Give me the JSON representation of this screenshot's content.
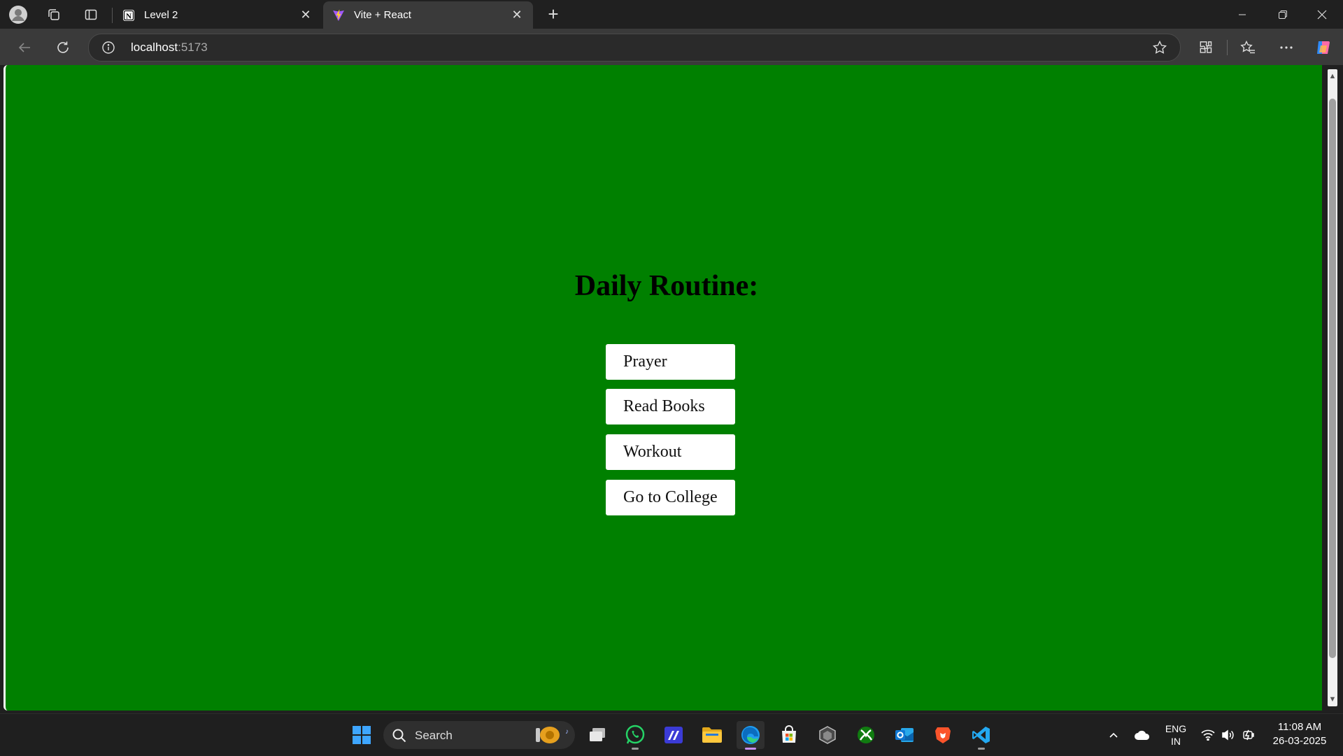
{
  "browser": {
    "tabs": [
      {
        "title": "Level 2",
        "active": false
      },
      {
        "title": "Vite + React",
        "active": true
      }
    ],
    "url_host": "localhost",
    "url_port": ":5173"
  },
  "page": {
    "heading": "Daily Routine:",
    "buttons": [
      "Prayer",
      "Read Books",
      "Workout",
      "Go to College"
    ],
    "background": "#008000"
  },
  "taskbar": {
    "search_label": "Search",
    "language": "ENG",
    "region": "IN",
    "time": "11:08 AM",
    "date": "26-03-2025"
  },
  "colors": {
    "accent_active_tab_indicator": "#c690f0",
    "page_green": "#008000"
  }
}
